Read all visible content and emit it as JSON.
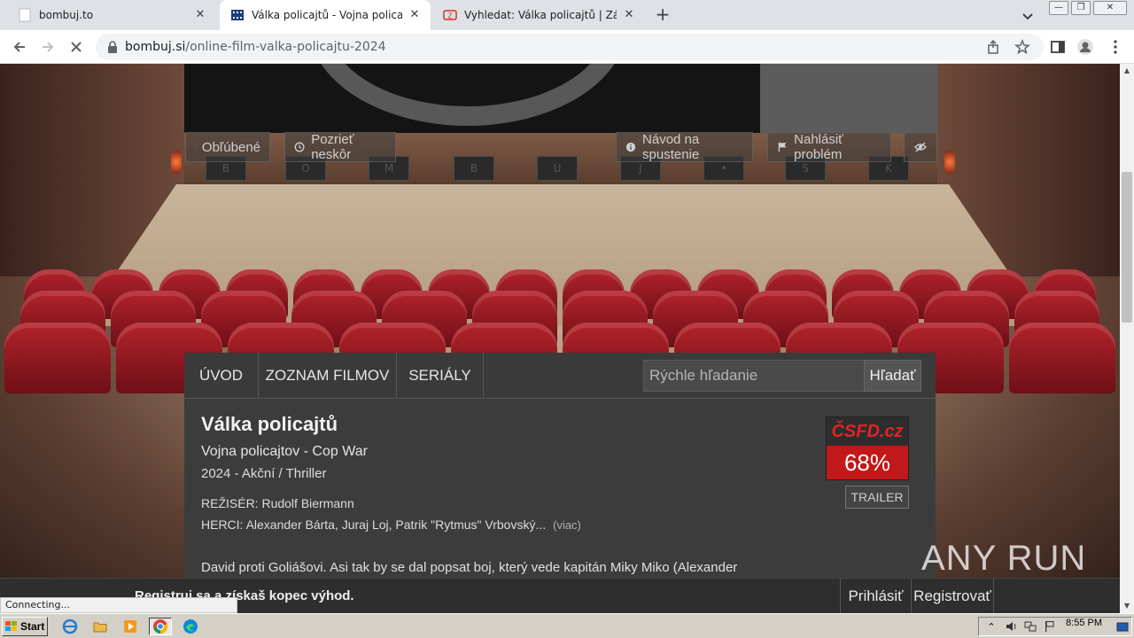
{
  "browser": {
    "tabs": [
      {
        "title": "bombuj.to",
        "icon": "blank-page-icon"
      },
      {
        "title": "Válka policajtů - Vojna policajtov online",
        "icon": "film-strip-icon"
      },
      {
        "title": "Vyhledat: Válka policajtů | Zálohuj.si",
        "icon": "zalohuj-icon"
      }
    ],
    "url_host": "bombuj.si",
    "url_path": "/online-film-valka-policajtu-2024",
    "status_text": "Connecting..."
  },
  "page": {
    "actions": {
      "favorite": "Obľúbené",
      "watch_later": "Pozrieť neskôr",
      "guide": "Návod na spustenie",
      "report": "Nahlásiť problém"
    },
    "stage_letters": [
      "B",
      "O",
      "M",
      "B",
      "U",
      "J",
      "•",
      "S",
      "K"
    ],
    "nav": {
      "home": "ÚVOD",
      "movies": "ZOZNAM FILMOV",
      "series": "SERIÁLY",
      "search_placeholder": "Rýchle hľadanie",
      "search_button": "Hľadať"
    },
    "movie": {
      "title": "Válka policajtů",
      "subtitle": "Vojna policajtov - Cop War",
      "meta": "2024 - Akční / Thriller",
      "director": "REŽISÉR: Rudolf Biermann",
      "cast": "HERCI: Alexander Bárta, Juraj Loj, Patrik \"Rytmus\" Vrbovský...",
      "cast_more": "(viac)",
      "description": "David proti Goliášovi. Asi tak by se dal popsat boj, který vede kapitán Miky Miko (Alexander",
      "rating_logo": "ČSFD.cz",
      "rating_value": "68%",
      "trailer": "TRAILER"
    },
    "sticky": {
      "promo": "Registruj sa a získaš kopec výhod.",
      "login": "Prihlásiť",
      "register": "Registrovať"
    },
    "watermark": "ANY RUN"
  },
  "taskbar": {
    "start": "Start",
    "clock": "8:55 PM"
  }
}
